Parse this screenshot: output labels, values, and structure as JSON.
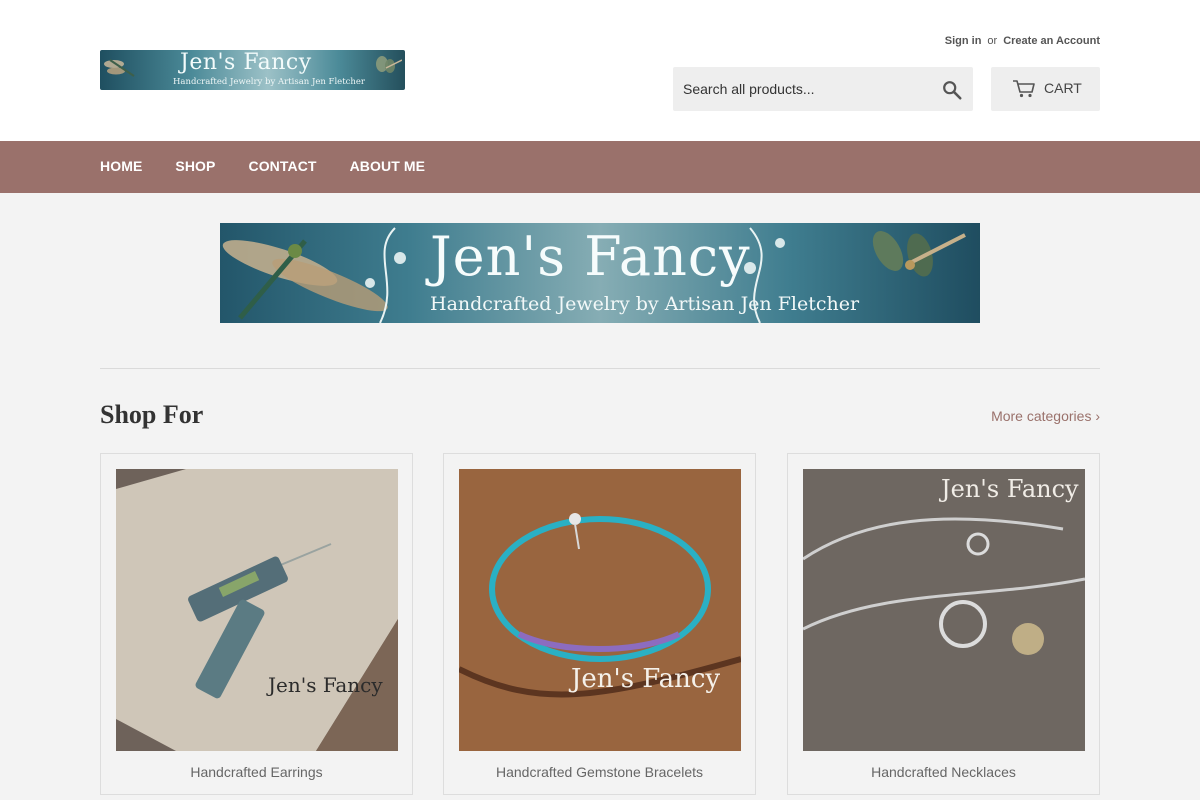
{
  "header": {
    "logo": {
      "title": "Jen's Fancy",
      "tagline": "Handcrafted Jewelry by Artisan Jen Fletcher"
    },
    "account": {
      "sign_in": "Sign in",
      "or": "or",
      "create_account": "Create an Account"
    },
    "search": {
      "placeholder": "Search all products...",
      "icon": "search-icon"
    },
    "cart": {
      "label": "CART",
      "icon": "cart-icon"
    }
  },
  "nav": {
    "items": [
      {
        "label": "HOME"
      },
      {
        "label": "SHOP"
      },
      {
        "label": "CONTACT"
      },
      {
        "label": "ABOUT ME"
      }
    ],
    "background_color": "#9a716b"
  },
  "banner": {
    "title": "Jen's Fancy",
    "tagline": "Handcrafted Jewelry by Artisan Jen Fletcher"
  },
  "main": {
    "section_title": "Shop For",
    "more_link": "More categories ›",
    "categories": [
      {
        "name": "Handcrafted Earrings",
        "watermark": "Jen's Fancy"
      },
      {
        "name": "Handcrafted Gemstone Bracelets",
        "watermark": "Jen's Fancy"
      },
      {
        "name": "Handcrafted Necklaces",
        "watermark": "Jen's Fancy"
      }
    ]
  },
  "colors": {
    "accent": "#9a716b",
    "header_bg": "#ffffff",
    "page_bg": "#f3f3f3"
  }
}
